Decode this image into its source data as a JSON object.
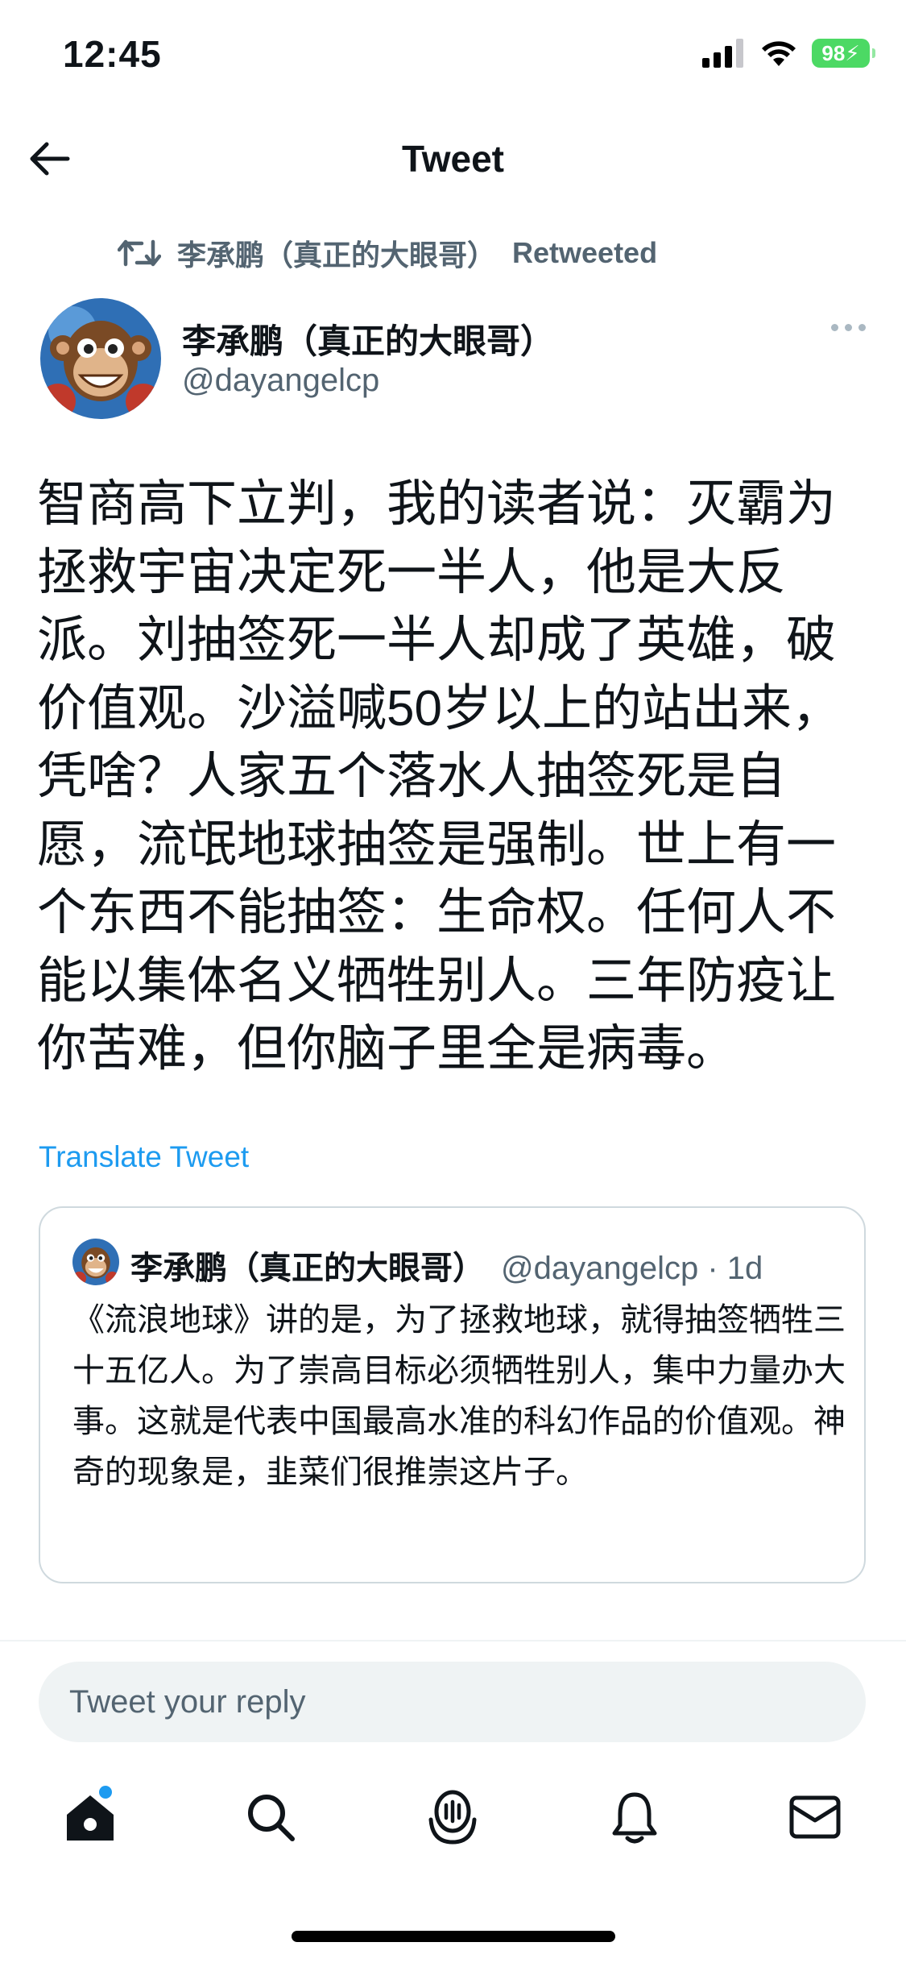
{
  "status_bar": {
    "time": "12:45",
    "battery": "98"
  },
  "header": {
    "title": "Tweet"
  },
  "retweet": {
    "retweeter": "李承鹏（真正的大眼哥）",
    "label": "Retweeted"
  },
  "author": {
    "name": "李承鹏（真正的大眼哥）",
    "handle": "@dayangelcp"
  },
  "tweet": {
    "text": "智商高下立判，我的读者说：灭霸为拯救宇宙决定死一半人，他是大反派。刘抽签死一半人却成了英雄，破价值观。沙溢喊50岁以上的站出来，凭啥？人家五个落水人抽签死是自愿，流氓地球抽签是强制。世上有一个东西不能抽签：生命权。任何人不能以集体名义牺牲别人。三年防疫让你苦难，但你脑子里全是病毒。",
    "translate_label": "Translate Tweet"
  },
  "quote": {
    "name": "李承鹏（真正的大眼哥）",
    "meta": "@dayangelcp · 1d",
    "text": "《流浪地球》讲的是，为了拯救地球，就得抽签牺牲三十五亿人。为了崇高目标必须牺牲别人，集中力量办大事。这就是代表中国最高水准的科幻作品的价值观。神奇的现象是，韭菜们很推崇这片子。"
  },
  "reply": {
    "placeholder": "Tweet your reply"
  },
  "tabs": [
    {
      "icon": "home-icon"
    },
    {
      "icon": "search-icon"
    },
    {
      "icon": "spaces-icon"
    },
    {
      "icon": "bell-icon"
    },
    {
      "icon": "mail-icon"
    }
  ],
  "colors": {
    "accent": "#1d9bf0",
    "secondary_text": "#536471",
    "battery": "#4cd964"
  }
}
